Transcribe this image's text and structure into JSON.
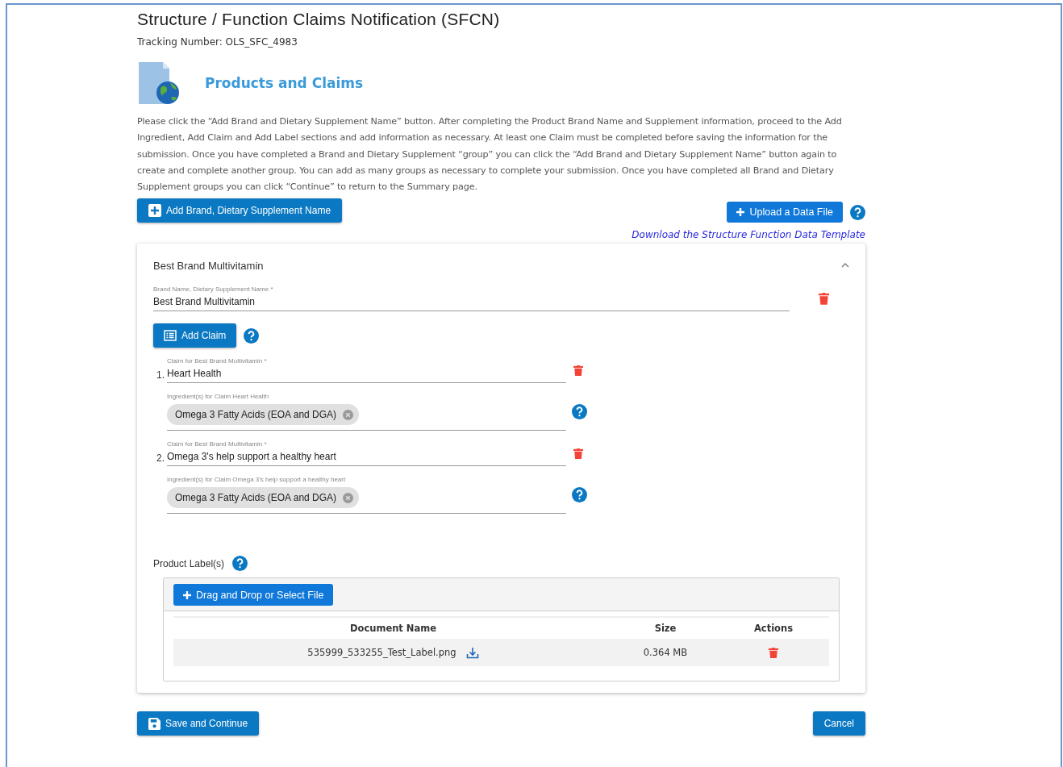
{
  "title": "Structure / Function Claims Notification (SFCN)",
  "tracking": "Tracking Number: OLS_SFC_4983",
  "section_title": "Products and Claims",
  "instructions": "Please click the “Add Brand and Dietary Supplement Name” button. After completing the Product Brand Name and Supplement information, proceed to the Add Ingredient, Add Claim and Add Label sections and add information as necessary. At least one Claim must be completed before saving the information for the submission. Once you have completed a Brand and Dietary Supplement “group” you can click the “Add Brand and Dietary Supplement Name” button again to create and complete another group. You can add as many groups as necessary to complete your submission. Once you have completed all Brand and Dietary Supplement groups you can click “Continue” to return to the Summary page.",
  "add_brand_button": "Add Brand, Dietary Supplement Name",
  "upload_button": "Upload a Data File",
  "template_link": "Download the Structure Function Data Template",
  "group": {
    "title": "Best Brand Multivitamin",
    "expanded": true,
    "brand_label": "Brand Name, Dietary Supplement Name *",
    "brand_value": "Best Brand Multivitamin",
    "add_claim_button": "Add Claim",
    "claims": [
      {
        "number": "1.",
        "label": "Claim for Best Brand Multivitamin *",
        "value": "Heart Health",
        "ingredient_label": "Ingredient(s) for Claim Heart Health",
        "ingredients": [
          "Omega 3 Fatty Acids (EOA and DGA)"
        ]
      },
      {
        "number": "2.",
        "label": "Claim for Best Brand Multivitamin *",
        "value": "Omega 3's help support a healthy heart",
        "ingredient_label": "Ingredient(s) for Claim Omega 3's help support a healthy heart",
        "ingredients": [
          "Omega 3 Fatty Acids (EOA and DGA)"
        ]
      }
    ],
    "labels_title": "Product Label(s)",
    "drop_button": "Drag and Drop or Select File",
    "columns": [
      "Document Name",
      "Size",
      "Actions"
    ],
    "files": [
      {
        "name": "535999_533255_Test_Label.png",
        "size": "0.364 MB"
      }
    ]
  },
  "save_button": "Save and Continue",
  "cancel_button": "Cancel"
}
